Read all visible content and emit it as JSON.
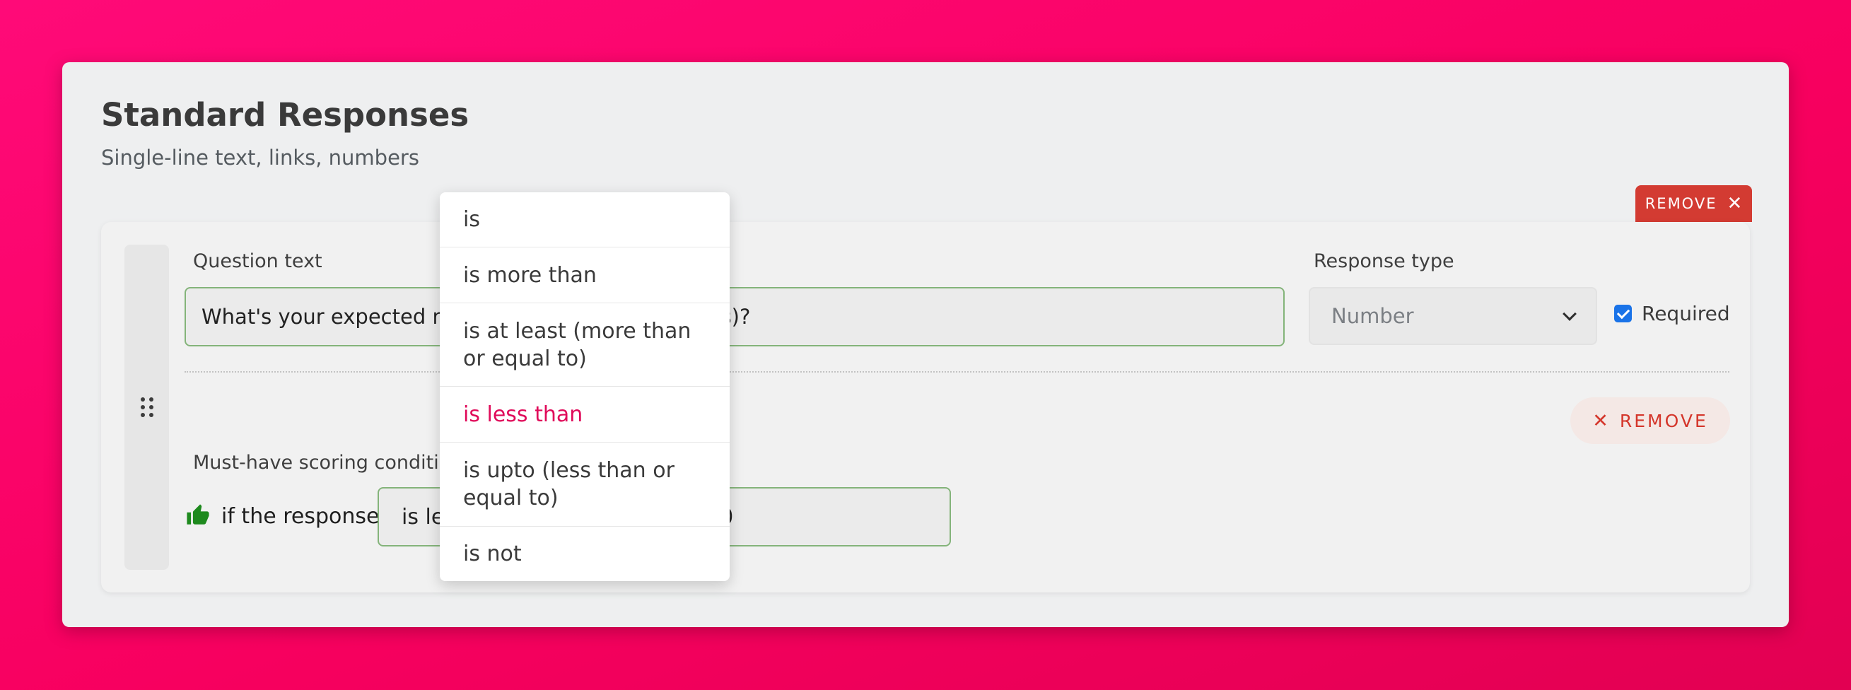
{
  "section": {
    "title": "Standard Responses",
    "subtitle": "Single-line text, links, numbers"
  },
  "remove_tag": {
    "label": "REMOVE"
  },
  "question": {
    "label": "Question text",
    "value": "What's your expected monthly salary (in thousands)?",
    "response_type_label": "Response type",
    "response_type_value": "Number",
    "required_label": "Required",
    "required_checked": true
  },
  "condition": {
    "remove_label": "REMOVE",
    "section_label": "Must-have scoring conditions",
    "prefix": "if the response",
    "operator": "is less than",
    "value": "20"
  },
  "dropdown": {
    "options": [
      "is",
      "is more than",
      "is at least (more than or equal to)",
      "is less than",
      "is upto (less than or equal to)",
      "is not"
    ],
    "selected": "is less than"
  },
  "icons": {
    "drag_handle": "drag-handle-icon",
    "thumb": "thumbs-up-icon",
    "close": "close-icon",
    "chevron": "chevron-down-icon",
    "check": "check-icon"
  },
  "colors": {
    "accent_pink": "#e00b5a",
    "remove_red": "#d33b32",
    "input_border_green": "#84b47a",
    "thumb_green": "#1e8a1e",
    "checkbox_blue": "#1a73e8"
  }
}
